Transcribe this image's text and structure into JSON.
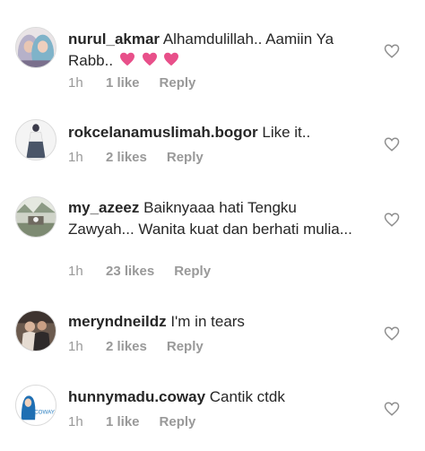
{
  "colors": {
    "text": "#262626",
    "meta": "#999999",
    "heart_emoji": "#e8508a",
    "like_outline": "#8e8e8e"
  },
  "comments": [
    {
      "username": "nurul_akmar",
      "text": "Alhamdulillah.. Aamiin Ya Rabb..",
      "emoji": [
        "pink-heart-icon",
        "pink-heart-icon",
        "pink-heart-icon"
      ],
      "time": "1h",
      "likes": "1 like",
      "reply": "Reply",
      "avatar": "avatar-hijab-women"
    },
    {
      "username": "rokcelanamuslimah.bogor",
      "text": "Like it..",
      "time": "1h",
      "likes": "2 likes",
      "reply": "Reply",
      "avatar": "avatar-fashion-figure"
    },
    {
      "username": "my_azeez",
      "text": "Baiknyaaa hati Tengku Zawyah... Wanita kuat dan berhati mulia...",
      "time": "1h",
      "likes": "23 likes",
      "reply": "Reply",
      "avatar": "avatar-garden-scene"
    },
    {
      "username": "meryndneildz",
      "text": "I'm in tears",
      "time": "1h",
      "likes": "2 likes",
      "reply": "Reply",
      "avatar": "avatar-couple-photo"
    },
    {
      "username": "hunnymadu.coway",
      "text": "Cantik ctdk",
      "time": "1h",
      "likes": "1 like",
      "reply": "Reply",
      "avatar": "avatar-coway-logo",
      "avatar_label": "COWAY"
    }
  ]
}
